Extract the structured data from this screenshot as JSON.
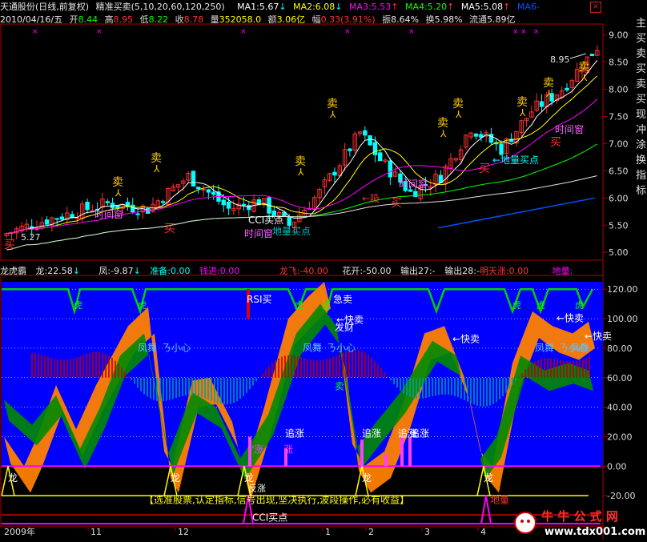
{
  "header": {
    "stock": "天通股份(日线,前复权)",
    "indicator": "精准买卖(5,10,20,60,120,250)",
    "ma1": {
      "label": "MA1:5.67",
      "color": "#ffffff",
      "arrow": "↓"
    },
    "ma2": {
      "label": "MA2:6.08",
      "color": "#ffff00",
      "arrow": "↓"
    },
    "ma3": {
      "label": "MA3:5.53",
      "color": "#ff00ff",
      "arrow": "↑"
    },
    "ma4": {
      "label": "MA4:5.20",
      "color": "#00ff00",
      "arrow": "↑"
    },
    "ma5": {
      "label": "MA5:5.08",
      "color": "#ffffff",
      "arrow": "↑"
    },
    "ma6": {
      "label": "MA6",
      "color": "#0050ff",
      "arrow": "-"
    }
  },
  "info": {
    "date": "2010/04/16/五",
    "open_label": "开",
    "open": "8.44",
    "high_label": "高",
    "high": "8.95",
    "low_label": "低",
    "low": "8.22",
    "close_label": "收",
    "close": "8.78",
    "vol_label": "量",
    "vol": "352058.0",
    "amt_label": "额",
    "amt": "3.06亿",
    "chg_label": "幅",
    "chg": "0.33(3.91%)",
    "amp_label": "振",
    "amp": "8.64%",
    "turn_label": "换",
    "turn": "5.98%",
    "float_label": "流通",
    "float": "5.89亿"
  },
  "indicator_bar": {
    "name": "龙虎霸",
    "long": "龙:22.58",
    "long_arrow": "↓",
    "feng": "凤:-9.87",
    "feng_arrow": "↓",
    "zhunbei": "准备:0.00",
    "qianjin": "钱进:0.00",
    "longfei": "龙飞:-40.00",
    "huakai": "花开:-50.00",
    "shuchu27": "输出27:-",
    "shuchu28": "输出28:-",
    "mingtianzhang": "明天涨:0.00",
    "diliang": "地量:"
  },
  "price_axis": [
    "9.00",
    "8.50",
    "8.00",
    "7.50",
    "7.00",
    "6.50",
    "6.00",
    "5.50",
    "5.00"
  ],
  "ind_axis": [
    "120.00",
    "100.00",
    "80.00",
    "60.00",
    "40.00",
    "20.00",
    "0.00",
    "-20.00"
  ],
  "time_axis": [
    "2009年",
    "11",
    "12",
    "1",
    "2",
    "3",
    "4"
  ],
  "annotations": {
    "sell": "卖",
    "buy": "买",
    "shijianchuang": "时间窗",
    "cci_buy": "CCI买点",
    "diliang_buy": "地量买点",
    "diliang_buy_arrow": "←地量买点",
    "xi": "←吸",
    "high_mark": "8.95",
    "low_mark": "5.27",
    "rsi_buy": "RSI买",
    "ji_mai": "急卖",
    "kuai_mai": "←快卖",
    "fa_cai": "发财",
    "fengwu": "凤舞",
    "xiaoxin": "ㄋ小心",
    "zhuizhang": "追涨",
    "long_char": "龙",
    "hu_char": "虎",
    "diliang": "地量",
    "banner": "【选准股票,认定指标,信号出现,坚决执行,波段操作,必有收益】",
    "fanzhang": "反涨",
    "zhang_q": "\"涨",
    "zhang": "涨"
  },
  "right_strip": [
    "主",
    "买",
    "卖",
    "买",
    "卖",
    "买",
    "现",
    "冲",
    "涂",
    "换",
    "指",
    "标"
  ],
  "watermark": {
    "title": "牛 牛 公 式 网",
    "url": "www.tdx001.com"
  },
  "colors": {
    "up": "#ff3030",
    "down": "#00ffff",
    "bg": "#000000",
    "blue_fill": "#0000ff",
    "orange": "#ff7f00",
    "green": "#00b000",
    "magenta": "#ff00ff",
    "yellow": "#ffff00"
  },
  "chart_data": {
    "type": "candlestick",
    "price_ylim": [
      4.9,
      9.2
    ],
    "ind_ylim": [
      -40,
      125
    ],
    "price_ticks": [
      5.0,
      5.5,
      6.0,
      6.5,
      7.0,
      7.5,
      8.0,
      8.5,
      9.0
    ],
    "ind_ticks": [
      120,
      100,
      80,
      60,
      40,
      20,
      0,
      -20
    ],
    "high_value": 8.95,
    "low_value": 5.27
  }
}
